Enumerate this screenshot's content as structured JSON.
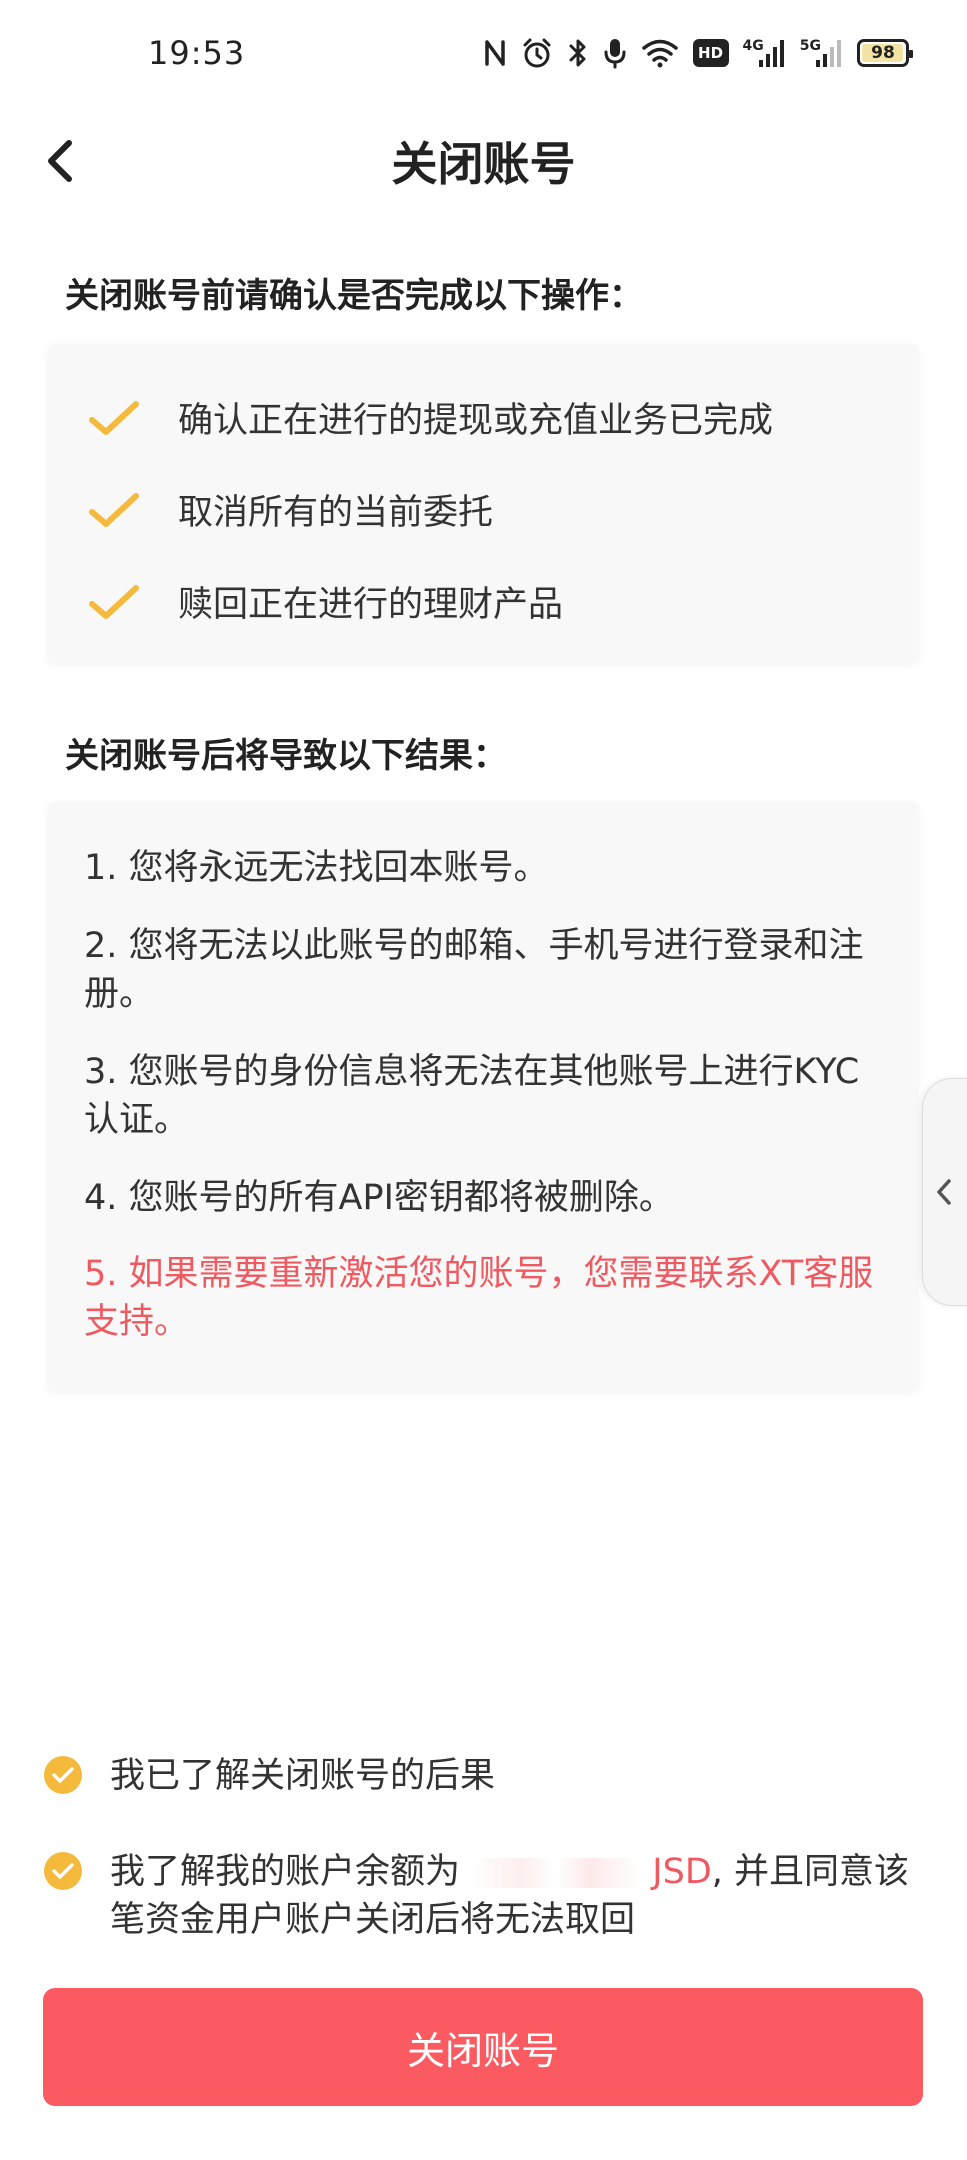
{
  "status_bar": {
    "time": "19:53",
    "hd_label": "HD",
    "net1_label": "4G",
    "net2_label": "5G",
    "battery_percent": 98,
    "battery_text": "98",
    "icons": [
      "nfc-icon",
      "alarm-icon",
      "bluetooth-icon",
      "microphone-icon",
      "wifi-icon",
      "hd-icon",
      "signal-4g-icon",
      "signal-5g-icon",
      "battery-icon"
    ]
  },
  "header": {
    "title": "关闭账号",
    "back_icon": "chevron-left-icon"
  },
  "before_section": {
    "heading": "关闭账号前请确认是否完成以下操作：",
    "items": [
      "确认正在进行的提现或充值业务已完成",
      "取消所有的当前委托",
      "赎回正在进行的理财产品"
    ]
  },
  "after_section": {
    "heading": "关闭账号后将导致以下结果：",
    "items": [
      {
        "text": "1. 您将永远无法找回本账号。",
        "warning": false
      },
      {
        "text": "2. 您将无法以此账号的邮箱、手机号进行登录和注册。",
        "warning": false
      },
      {
        "text": "3. 您账号的身份信息将无法在其他账号上进行KYC认证。",
        "warning": false
      },
      {
        "text": "4. 您账号的所有API密钥都将被删除。",
        "warning": false
      },
      {
        "text": "5. 如果需要重新激活您的账号，您需要联系XT客服支持。",
        "warning": true
      }
    ]
  },
  "agreements": {
    "item1": "我已了解关闭账号的后果",
    "item2_prefix": "我了解我的账户余额为",
    "item2_amount": "JSD",
    "item2_suffix": ", 并且同意该笔资金用户账户关闭后将无法取回"
  },
  "button": {
    "label": "关闭账号"
  },
  "colors": {
    "accent_yellow": "#f5b93c",
    "warning_red": "#ef5a61",
    "button_red": "#fc5a61",
    "card_bg": "#f8f8f8"
  }
}
